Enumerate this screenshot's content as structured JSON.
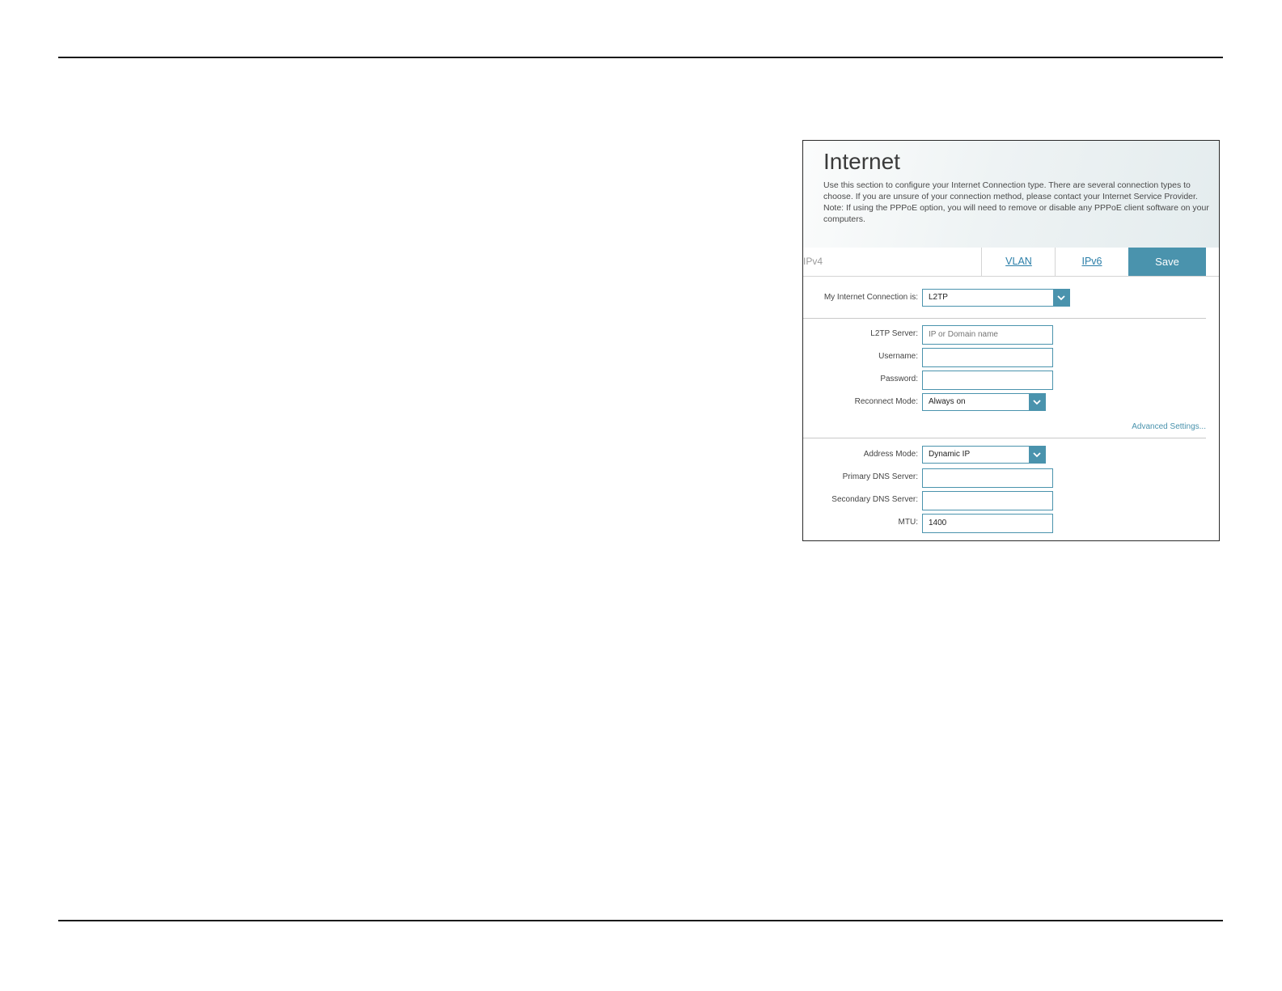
{
  "panel": {
    "title": "Internet",
    "description": "Use this section to configure your Internet Connection type. There are several connection types to choose. If you are unsure of your connection method, please contact your Internet Service Provider. Note: If using the PPPoE option, you will need to remove or disable any PPPoE client software on your computers."
  },
  "tabs": {
    "current": "IPv4",
    "vlan": "VLAN",
    "ipv6": "IPv6",
    "save": "Save"
  },
  "connection": {
    "label": "My Internet Connection is:",
    "value": "L2TP"
  },
  "l2tp": {
    "server": {
      "label": "L2TP Server:",
      "value": "",
      "placeholder": "IP or Domain name"
    },
    "username": {
      "label": "Username:",
      "value": ""
    },
    "password": {
      "label": "Password:",
      "value": ""
    },
    "reconnect": {
      "label": "Reconnect Mode:",
      "value": "Always on"
    }
  },
  "advanced_link": "Advanced Settings...",
  "address": {
    "mode": {
      "label": "Address Mode:",
      "value": "Dynamic IP"
    },
    "primary_dns": {
      "label": "Primary DNS Server:",
      "value": ""
    },
    "secondary_dns": {
      "label": "Secondary DNS Server:",
      "value": ""
    },
    "mtu": {
      "label": "MTU:",
      "value": "1400"
    }
  },
  "colors": {
    "accent": "#4a93ad",
    "link": "#2a7ea8",
    "rule": "#1a1a1a"
  },
  "icons": {
    "dropdown": "chevron-down-icon"
  }
}
